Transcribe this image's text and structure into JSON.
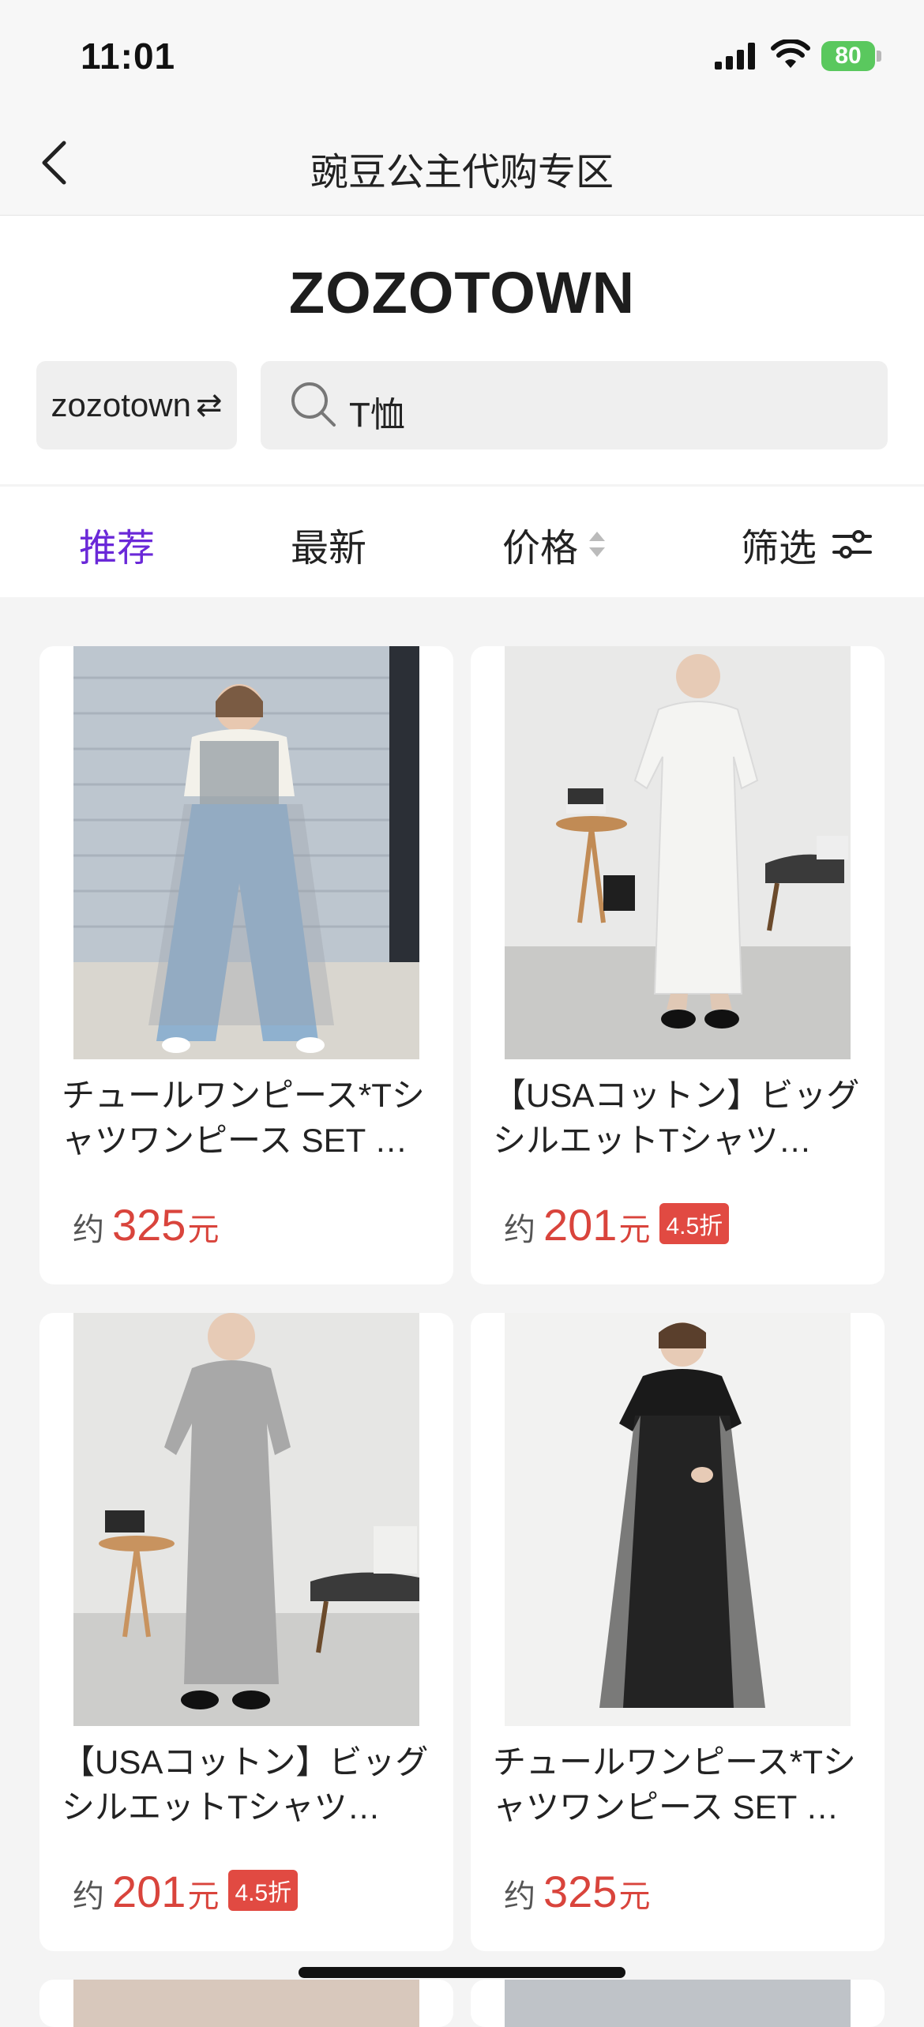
{
  "status": {
    "time": "11:01",
    "battery": "80"
  },
  "nav": {
    "title": "豌豆公主代购专区"
  },
  "brand": {
    "logo": "ZOZOTOWN",
    "store": "zozotown",
    "swap_glyph": "⇄"
  },
  "search": {
    "query": "T恤"
  },
  "sort": {
    "recommend": "推荐",
    "newest": "最新",
    "price": "价格",
    "filter": "筛选",
    "active": "recommend"
  },
  "products": [
    {
      "title": "チュールワンピース*Tシャツワンピース SET …",
      "approx": "约",
      "price": "325",
      "unit": "元",
      "discount": ""
    },
    {
      "title": "【USAコットン】ビッグシルエットTシャツ…",
      "approx": "约",
      "price": "201",
      "unit": "元",
      "discount": "4.5折"
    },
    {
      "title": "【USAコットン】ビッグシルエットTシャツ…",
      "approx": "约",
      "price": "201",
      "unit": "元",
      "discount": "4.5折"
    },
    {
      "title": "チュールワンピース*Tシャツワンピース SET …",
      "approx": "约",
      "price": "325",
      "unit": "元",
      "discount": ""
    }
  ],
  "colors": {
    "accent": "#6a28d8",
    "price": "#d9443c",
    "discount_bg": "#e14a42"
  },
  "icons": [
    "signal-icon",
    "wifi-icon",
    "battery-icon",
    "back-chevron-icon",
    "swap-icon",
    "search-icon",
    "sort-arrows-icon",
    "filter-sliders-icon"
  ]
}
